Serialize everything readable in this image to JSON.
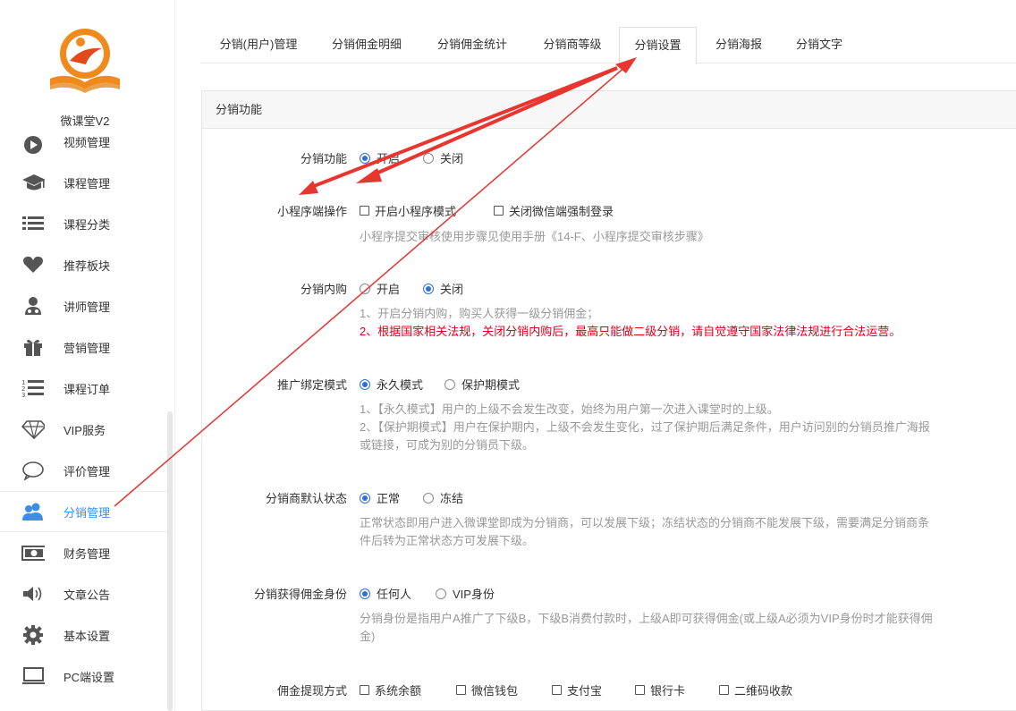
{
  "app": {
    "name": "微课堂V2"
  },
  "sidebar": {
    "items": [
      {
        "label": "视频管理",
        "icon": "play-icon"
      },
      {
        "label": "课程管理",
        "icon": "graduation-cap-icon"
      },
      {
        "label": "课程分类",
        "icon": "list-icon"
      },
      {
        "label": "推荐板块",
        "icon": "heart-icon"
      },
      {
        "label": "讲师管理",
        "icon": "teacher-icon"
      },
      {
        "label": "营销管理",
        "icon": "gift-icon"
      },
      {
        "label": "课程订单",
        "icon": "ordered-list-icon"
      },
      {
        "label": "VIP服务",
        "icon": "diamond-icon"
      },
      {
        "label": "评价管理",
        "icon": "chat-bubble-icon"
      },
      {
        "label": "分销管理",
        "icon": "users-icon",
        "active": true
      },
      {
        "label": "财务管理",
        "icon": "money-icon"
      },
      {
        "label": "文章公告",
        "icon": "speaker-icon"
      },
      {
        "label": "基本设置",
        "icon": "gear-icon"
      },
      {
        "label": "PC端设置",
        "icon": "monitor-icon"
      }
    ]
  },
  "tabs": [
    "分销(用户)管理",
    "分销佣金明细",
    "分销佣金统计",
    "分销商等级",
    "分销设置",
    "分销海报",
    "分销文字"
  ],
  "active_tab": "分销设置",
  "panel": {
    "title": "分销功能"
  },
  "form": {
    "distribution": {
      "label": "分销功能",
      "on": "开启",
      "off": "关闭",
      "selected": "开启"
    },
    "miniprogram": {
      "label": "小程序端操作",
      "opt1": "开启小程序模式",
      "opt2": "关闭微信端强制登录",
      "help": "小程序提交审核使用步骤见使用手册《14-F、小程序提交审核步骤》"
    },
    "inner_buy": {
      "label": "分销内购",
      "on": "开启",
      "off": "关闭",
      "selected": "关闭",
      "help1": "1、开启分销内购，购买人获得一级分销佣金；",
      "help2": "2、根据国家相关法规，关闭分销内购后，最高只能做二级分销，请自觉遵守国家法律法规进行合法运营。"
    },
    "bind_mode": {
      "label": "推广绑定模式",
      "opt1": "永久模式",
      "opt2": "保护期模式",
      "selected": "永久模式",
      "help1": "1、【永久模式】用户的上级不会发生改变，始终为用户第一次进入课堂时的上级。",
      "help2": "2、【保护期模式】用户在保护期内，上级不会发生变化，过了保护期后满足条件，用户访问别的分销员推广海报",
      "help3": "或链接，可成为别的分销员下级。"
    },
    "default_status": {
      "label": "分销商默认状态",
      "opt1": "正常",
      "opt2": "冻结",
      "selected": "正常",
      "help1": "正常状态即用户进入微课堂即成为分销商，可以发展下级；冻结状态的分销商不能发展下级，需要满足分销商条",
      "help2": "件后转为正常状态方可发展下级。"
    },
    "commission_identity": {
      "label": "分销获得佣金身份",
      "opt1": "任何人",
      "opt2": "VIP身份",
      "selected": "任何人",
      "help1": "分销身份是指用户A推广了下级B，下级B消费付款时，上级A即可获得佣金(或上级A必须为VIP身份时才能获得佣",
      "help2": "金)"
    },
    "withdraw": {
      "label": "佣金提现方式",
      "opts": [
        "系统余额",
        "微信钱包",
        "支付宝",
        "银行卡",
        "二维码收款"
      ]
    }
  },
  "colors": {
    "accent": "#2f6fd8",
    "warning_red": "#d9001b",
    "annotation_red": "#e8352f",
    "logo_orange": "#f08a1c"
  }
}
